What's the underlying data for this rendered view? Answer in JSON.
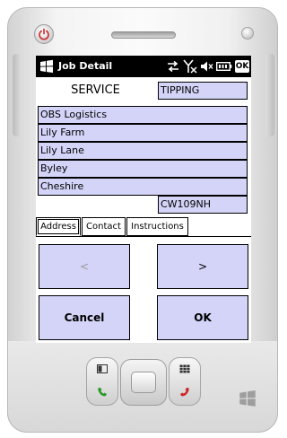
{
  "window": {
    "title": "Job Detail",
    "ok_label": "OK"
  },
  "form": {
    "service_label": "SERVICE",
    "service_type": "TIPPING",
    "address_lines": [
      "OBS Logistics",
      "Lily Farm",
      "Lily Lane",
      "Byley",
      "Cheshire"
    ],
    "postcode": "CW109NH"
  },
  "tabs": [
    {
      "label": "Address",
      "active": true
    },
    {
      "label": "Contact",
      "active": false
    },
    {
      "label": "Instructions",
      "active": false
    }
  ],
  "buttons": {
    "prev": "<",
    "next": ">",
    "cancel": "Cancel",
    "ok": "OK"
  },
  "colors": {
    "field_background": "#d4d4f8",
    "titlebar_background": "#000000",
    "disabled_text": "#9a9a9a"
  },
  "icons": {
    "titlebar": [
      "windows-start-icon",
      "connectivity-icon",
      "signal-off-icon",
      "speaker-muted-icon",
      "battery-icon"
    ],
    "hardware": [
      "power-icon",
      "left-softkey-icon",
      "right-softkey-icon",
      "call-icon",
      "end-call-icon",
      "windows-logo-icon"
    ]
  }
}
